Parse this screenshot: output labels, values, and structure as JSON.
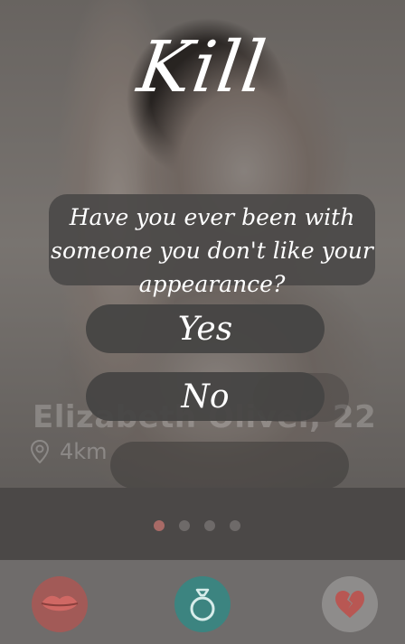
{
  "title": "Kill",
  "question": "Have you ever been with someone you don't like your appearance?",
  "answers": {
    "yes": "Yes",
    "no": "No"
  },
  "profile": {
    "name": "Elizabeth Oliver, 22",
    "distance": "4km"
  },
  "pager": {
    "count": 4,
    "active_index": 0
  },
  "actions": [
    {
      "name": "kiss",
      "icon": "lips-icon",
      "color": "#a25a57"
    },
    {
      "name": "marry",
      "icon": "ring-icon",
      "color": "#3c8480"
    },
    {
      "name": "kill",
      "icon": "broken-heart-icon",
      "color": "#8e8c8b"
    }
  ],
  "colors": {
    "accent_dot": "#a86a66",
    "overlay": "#4b4847"
  }
}
